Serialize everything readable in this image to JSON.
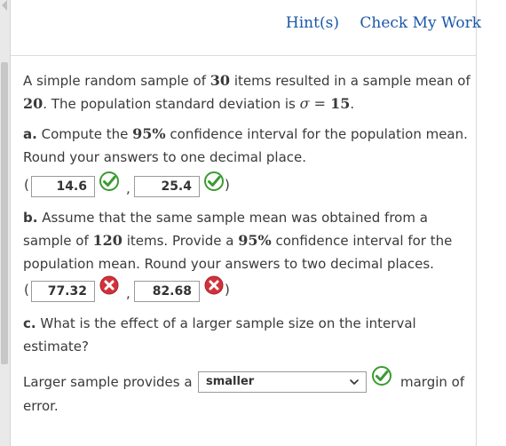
{
  "toolbar": {
    "hints_label": "Hint(s)",
    "check_label": "Check My Work"
  },
  "problem": {
    "intro_line1_a": "A simple random sample of ",
    "sample_size": "30",
    "intro_line1_b": " items resulted in a sample mean of",
    "sample_mean": "20",
    "intro_line2_b": ". The population standard deviation is ",
    "sigma_symbol": "σ",
    "equals": " = ",
    "sigma_value": "15",
    "period": "."
  },
  "part_a": {
    "label": "a.",
    "text1": " Compute the ",
    "confidence": "95%",
    "text2": " confidence interval for the population mean.",
    "line2": "Round your answers to one decimal place.",
    "lower": "14.6",
    "upper": "25.4",
    "lower_status": "correct",
    "upper_status": "correct"
  },
  "part_b": {
    "label": "b.",
    "line1": " Assume that the same sample mean was obtained from a",
    "line2_a": "sample of ",
    "n": "120",
    "line2_b": " items. Provide a ",
    "confidence": "95%",
    "line2_c": " confidence interval for the",
    "line3": "population mean. Round your answers to two decimal places.",
    "lower": "77.32",
    "upper": "82.68",
    "lower_status": "incorrect",
    "upper_status": "incorrect"
  },
  "part_c": {
    "label": "c.",
    "line1": " What is the effect of a larger sample size on the interval",
    "line2": "estimate?",
    "prefix": "Larger sample provides a",
    "selected": "smaller",
    "suffix1": "margin of",
    "suffix2": "error.",
    "status": "correct"
  },
  "punct": {
    "open_paren": "(",
    "comma": ",",
    "close_paren": ")"
  },
  "colors": {
    "link": "#1a56a7",
    "correct": "#3a9b2f",
    "incorrect": "#d0323c"
  }
}
